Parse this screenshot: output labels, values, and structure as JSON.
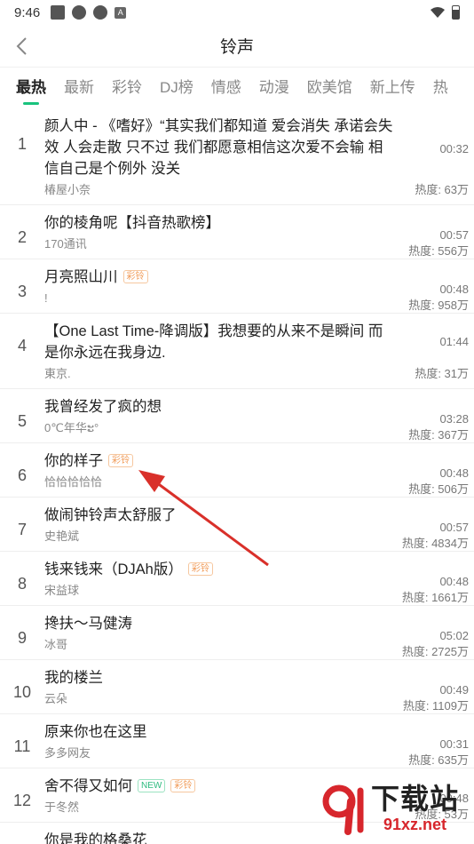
{
  "status_bar": {
    "time": "9:46",
    "notif_letter": "A"
  },
  "header": {
    "title": "铃声"
  },
  "tabs": [
    {
      "label": "最热",
      "active": true
    },
    {
      "label": "最新"
    },
    {
      "label": "彩铃"
    },
    {
      "label": "DJ榜"
    },
    {
      "label": "情感"
    },
    {
      "label": "动漫"
    },
    {
      "label": "欧美馆"
    },
    {
      "label": "新上传"
    },
    {
      "label": "热"
    }
  ],
  "tags": {
    "ring": "彩铃",
    "new": "NEW"
  },
  "songs": [
    {
      "rank": "1",
      "title": "颜人中 - 《嗜好》“其实我们都知道 爱会消失 承诺会失效 人会走散 只不过 我们都愿意相信这次爱不会输 相信自己是个例外 没关",
      "singer": "椿屋小奈",
      "duration": "00:32",
      "heat": "热度: 63万"
    },
    {
      "rank": "2",
      "title": "你的棱角呢【抖音热歌榜】",
      "singer": "170通讯",
      "duration": "00:57",
      "heat": "热度: 556万"
    },
    {
      "rank": "3",
      "title": "月亮照山川",
      "singer": "!",
      "duration": "00:48",
      "heat": "热度: 958万",
      "tag": "ring"
    },
    {
      "rank": "4",
      "title": "【One Last Time-降调版】我想要的从来不是瞬间 而是你永远在我身边.",
      "singer": "東京.",
      "duration": "01:44",
      "heat": "热度: 31万"
    },
    {
      "rank": "5",
      "title": "我曾经发了疯的想",
      "singer": "0℃年华ະ°",
      "duration": "03:28",
      "heat": "热度: 367万"
    },
    {
      "rank": "6",
      "title": "你的样子",
      "singer": "恰恰恰恰恰",
      "duration": "00:48",
      "heat": "热度: 506万",
      "tag": "ring"
    },
    {
      "rank": "7",
      "title": "做闹钟铃声太舒服了",
      "singer": "史艳斌",
      "duration": "00:57",
      "heat": "热度: 4834万"
    },
    {
      "rank": "8",
      "title": "钱来钱来（DJAh版）",
      "singer": "宋益球",
      "duration": "00:48",
      "heat": "热度: 1661万",
      "tag": "ring"
    },
    {
      "rank": "9",
      "title": "搀扶～马健涛",
      "singer": "冰哥",
      "duration": "05:02",
      "heat": "热度: 2725万"
    },
    {
      "rank": "10",
      "title": "我的楼兰",
      "singer": "云朵",
      "duration": "00:49",
      "heat": "热度: 1109万"
    },
    {
      "rank": "11",
      "title": "原来你也在这里",
      "singer": "多多网友",
      "duration": "00:31",
      "heat": "热度: 635万"
    },
    {
      "rank": "12",
      "title": "舍不得又如何",
      "singer": "于冬然",
      "duration": "00:48",
      "heat": "热度: 53万",
      "tag": "ring",
      "tag_new": true
    },
    {
      "rank": "13",
      "title": "你是我的格桑花",
      "singer": "",
      "duration": "",
      "heat": ""
    }
  ],
  "watermark": {
    "main": "下载站",
    "sub": "91xz.net",
    "logo": "91"
  },
  "colors": {
    "accent": "#19c37d",
    "arrow": "#d9302a",
    "ring_tag": "#f19b58",
    "new_tag": "#2dbb7f"
  }
}
